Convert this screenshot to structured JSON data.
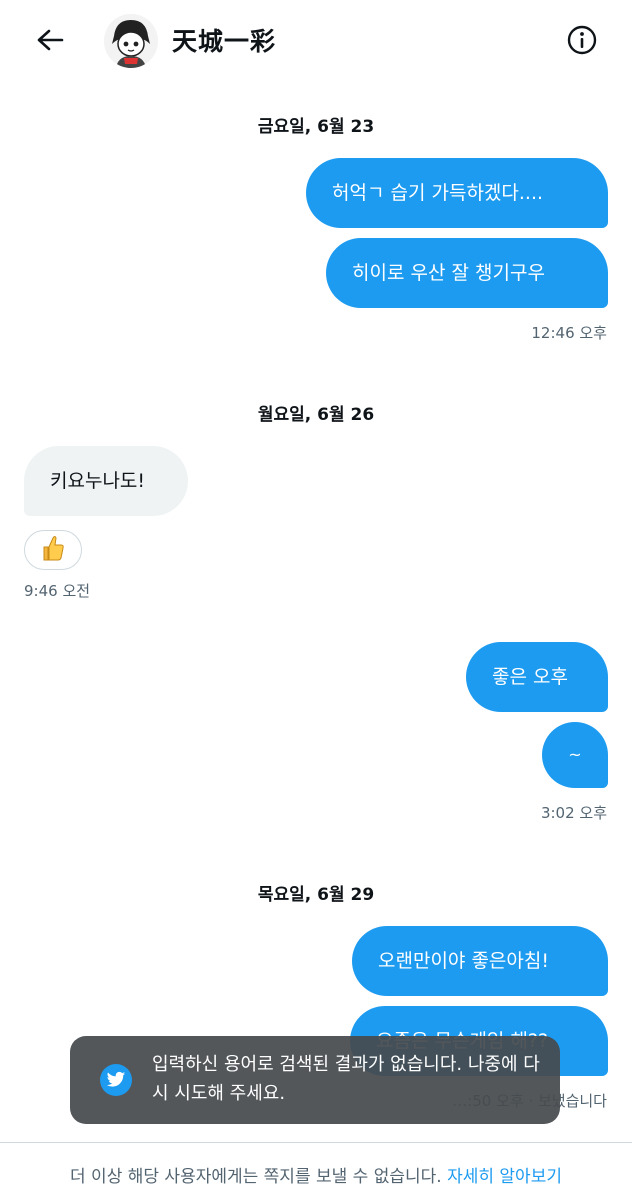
{
  "header": {
    "title": "天城一彩",
    "back_icon": "arrow-left-icon",
    "info_icon": "info-circle-icon"
  },
  "conversation": {
    "groups": [
      {
        "date": "금요일, 6월 23",
        "messages": [
          {
            "direction": "out",
            "text": "허억ㄱ 습기 가득하겠다...."
          },
          {
            "direction": "out",
            "text": "히이로 우산 잘 챙기구우"
          }
        ],
        "timestamp": "12:46 오후"
      },
      {
        "date": "월요일, 6월 26",
        "messages": [
          {
            "direction": "in",
            "text": "키요누나도!",
            "reaction": "👍"
          }
        ],
        "timestamp": "9:46 오전"
      },
      {
        "date": "",
        "messages": [
          {
            "direction": "out",
            "text": "좋은 오후"
          },
          {
            "direction": "out",
            "text": "~"
          }
        ],
        "timestamp": "3:02 오후"
      },
      {
        "date": "목요일, 6월 29",
        "messages": [
          {
            "direction": "out",
            "text": "오랜만이야 좋은아침!"
          },
          {
            "direction": "out",
            "text": "요즘은 무슨게임 해??"
          }
        ],
        "timestamp": "…:50 오후 · 보냈습니다"
      }
    ]
  },
  "toast": {
    "icon": "twitter-bird-icon",
    "text": "입력하신 용어로 검색된 결과가 없습니다. 나중에 다시 시도해 주세요."
  },
  "footer": {
    "text": "더 이상 해당 사용자에게는 쪽지를 보낼 수 없습니다.",
    "link": "자세히 알아보기"
  },
  "colors": {
    "accent": "#1d9bf0",
    "incoming_bubble": "#eff3f4",
    "muted_text": "#536471",
    "toast_bg": "#464a4d"
  }
}
